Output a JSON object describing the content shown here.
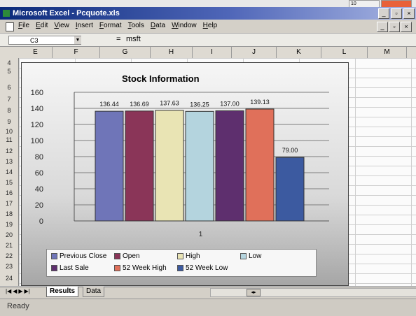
{
  "window": {
    "title": "Microsoft Excel - Pcquote.xls",
    "min_glyph": "_",
    "restore_glyph": "▫",
    "close_glyph": "×"
  },
  "top_tab_text": "10",
  "menu": [
    "File",
    "Edit",
    "View",
    "Insert",
    "Format",
    "Tools",
    "Data",
    "Window",
    "Help"
  ],
  "formula_bar": {
    "name_box": "C3",
    "equals": "=",
    "value": "msft"
  },
  "columns": [
    "E",
    "F",
    "G",
    "H",
    "I",
    "J",
    "K",
    "L",
    "M"
  ],
  "rows": [
    "4",
    "5",
    "6",
    "7",
    "8",
    "9",
    "10",
    "11",
    "12",
    "13",
    "14",
    "15",
    "16",
    "17",
    "18",
    "19",
    "20",
    "21",
    "22",
    "23",
    "24"
  ],
  "chart_data": {
    "type": "bar",
    "title": "Stock Information",
    "categories": [
      "1"
    ],
    "ylim": [
      0,
      160
    ],
    "yticks": [
      0,
      20,
      40,
      60,
      80,
      100,
      120,
      140,
      160
    ],
    "grid": true,
    "legend_position": "bottom",
    "series": [
      {
        "name": "Previous Close",
        "values": [
          136.44
        ],
        "label": "136.44",
        "color": "#6f75b8"
      },
      {
        "name": "Open",
        "values": [
          136.69
        ],
        "label": "136.69",
        "color": "#8a3558"
      },
      {
        "name": "High",
        "values": [
          137.63
        ],
        "label": "137.63",
        "color": "#e9e4b4"
      },
      {
        "name": "Low",
        "values": [
          136.25
        ],
        "label": "136.25",
        "color": "#b4d4de"
      },
      {
        "name": "Last Sale",
        "values": [
          137.0
        ],
        "label": "137.00",
        "color": "#5e2f6e"
      },
      {
        "name": "52 Week High",
        "values": [
          139.13
        ],
        "label": "139.13",
        "color": "#e0705a"
      },
      {
        "name": "52 Week Low",
        "values": [
          79.0
        ],
        "label": "79.00",
        "color": "#3c5aa0"
      }
    ]
  },
  "legend_rows": [
    [
      "Previous Close",
      "Open",
      "High",
      "Low"
    ],
    [
      "Last Sale",
      "52 Week High",
      "52 Week Low"
    ]
  ],
  "sheet_tabs": [
    "Results",
    "Data"
  ],
  "status": "Ready"
}
